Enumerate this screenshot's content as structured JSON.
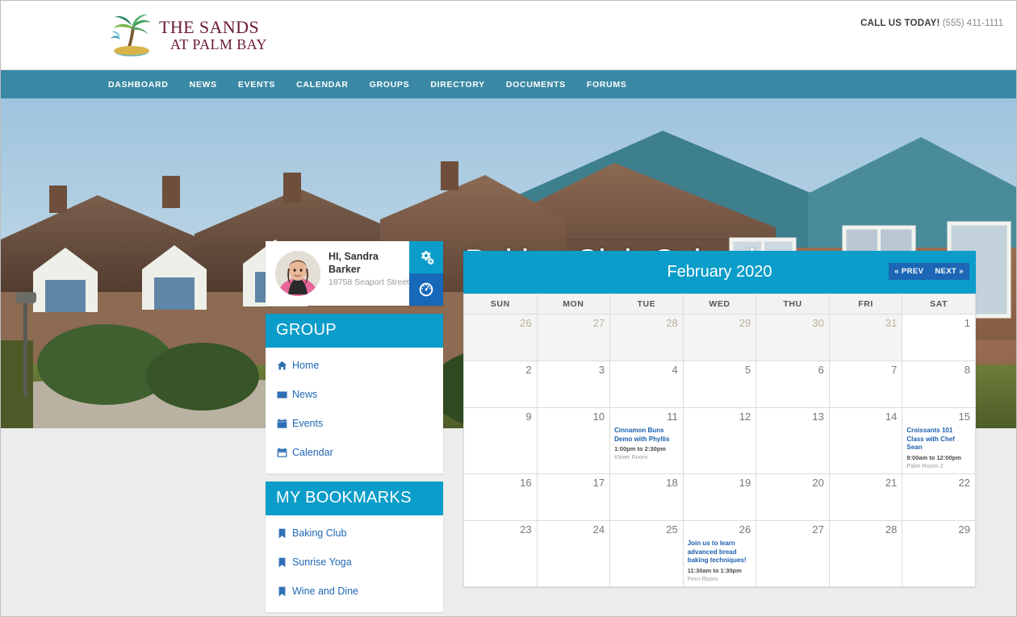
{
  "header": {
    "logo_line1": "THE SANDS",
    "logo_line2": "AT PALM BAY",
    "call_label": "CALL US TODAY!",
    "phone": "(555) 411-1111"
  },
  "nav": {
    "items": [
      {
        "label": "DASHBOARD"
      },
      {
        "label": "NEWS"
      },
      {
        "label": "EVENTS"
      },
      {
        "label": "CALENDAR"
      },
      {
        "label": "GROUPS"
      },
      {
        "label": "DIRECTORY"
      },
      {
        "label": "DOCUMENTS"
      },
      {
        "label": "FORUMS"
      }
    ]
  },
  "hero": {
    "title": "Baking Club Calendar"
  },
  "profile": {
    "greeting": "HI, Sandra Barker",
    "address": "18758 Seaport Street",
    "settings_icon": "gears-icon",
    "dashboard_icon": "gauge-icon"
  },
  "group_panel": {
    "title": "GROUP",
    "items": [
      {
        "label": "Home",
        "icon": "home-icon"
      },
      {
        "label": "News",
        "icon": "newspaper-icon"
      },
      {
        "label": "Events",
        "icon": "calendar-icon"
      },
      {
        "label": "Calendar",
        "icon": "calendar-alt-icon"
      }
    ]
  },
  "bookmarks_panel": {
    "title": "MY BOOKMARKS",
    "items": [
      {
        "label": "Baking Club",
        "icon": "bookmark-icon"
      },
      {
        "label": "Sunrise Yoga",
        "icon": "bookmark-icon"
      },
      {
        "label": "Wine and Dine",
        "icon": "bookmark-icon"
      }
    ]
  },
  "calendar": {
    "month_title": "February 2020",
    "prev_label": "« PREV",
    "next_label": "NEXT »",
    "weekdays": [
      "SUN",
      "MON",
      "TUE",
      "WED",
      "THU",
      "FRI",
      "SAT"
    ],
    "weeks": [
      [
        {
          "day": "26",
          "other": true
        },
        {
          "day": "27",
          "other": true
        },
        {
          "day": "28",
          "other": true
        },
        {
          "day": "29",
          "other": true
        },
        {
          "day": "30",
          "other": true
        },
        {
          "day": "31",
          "other": true
        },
        {
          "day": "1",
          "other": false
        }
      ],
      [
        {
          "day": "2",
          "other": false
        },
        {
          "day": "3",
          "other": false
        },
        {
          "day": "4",
          "other": false
        },
        {
          "day": "5",
          "other": false
        },
        {
          "day": "6",
          "other": false
        },
        {
          "day": "7",
          "other": false
        },
        {
          "day": "8",
          "other": false
        }
      ],
      [
        {
          "day": "9",
          "other": false
        },
        {
          "day": "10",
          "other": false
        },
        {
          "day": "11",
          "other": false,
          "event": {
            "title": "Cinnamon Buns Demo with Phyllis",
            "time": "1:00pm to 2:30pm",
            "room": "Kliner Room"
          }
        },
        {
          "day": "12",
          "other": false
        },
        {
          "day": "13",
          "other": false
        },
        {
          "day": "14",
          "other": false
        },
        {
          "day": "15",
          "other": false,
          "event": {
            "title": "Croissants 101 Class with Chef Sean",
            "time": "9:00am to 12:00pm",
            "room": "Palm Room 2"
          }
        }
      ],
      [
        {
          "day": "16",
          "other": false
        },
        {
          "day": "17",
          "other": false
        },
        {
          "day": "18",
          "other": false
        },
        {
          "day": "19",
          "other": false
        },
        {
          "day": "20",
          "other": false
        },
        {
          "day": "21",
          "other": false
        },
        {
          "day": "22",
          "other": false
        }
      ],
      [
        {
          "day": "23",
          "other": false
        },
        {
          "day": "24",
          "other": false
        },
        {
          "day": "25",
          "other": false
        },
        {
          "day": "26",
          "other": false,
          "event": {
            "title": "Join us to learn advanced bread baking techniques!",
            "time": "11:30am to 1:30pm",
            "room": "Fern Room"
          }
        },
        {
          "day": "27",
          "other": false
        },
        {
          "day": "28",
          "other": false
        },
        {
          "day": "29",
          "other": false
        }
      ]
    ]
  },
  "colors": {
    "nav_teal": "#3a89a4",
    "accent_blue": "#0b9dc9",
    "button_blue": "#1d66b5",
    "link_blue": "#2068b4",
    "logo_maroon": "#6b1a33",
    "page_bg": "#ececec"
  }
}
